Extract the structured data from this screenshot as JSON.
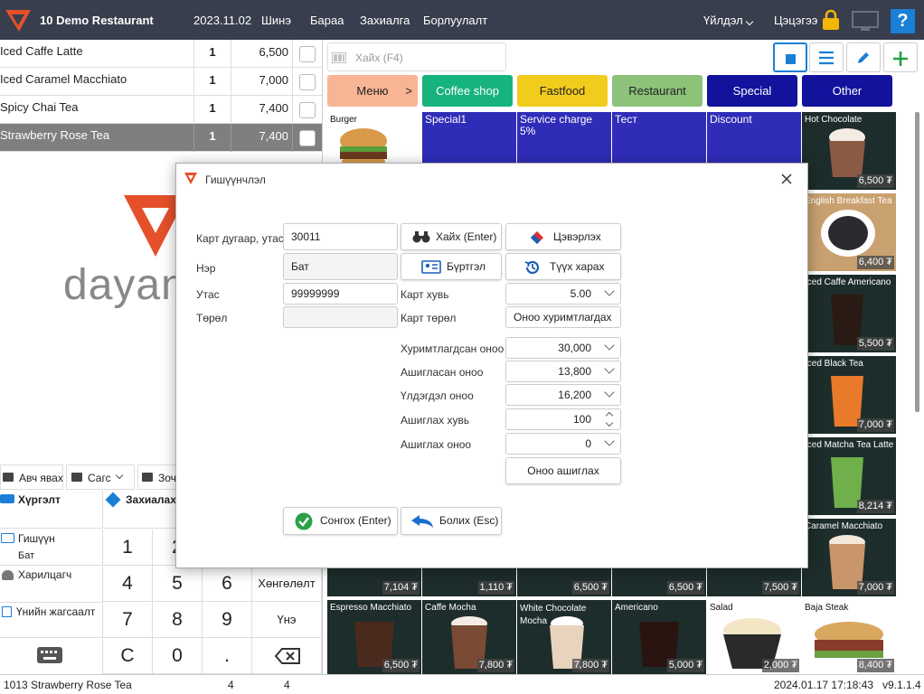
{
  "topbar": {
    "restaurant": "10 Demo Restaurant",
    "date": "2023.11.02",
    "menu": [
      "Шинэ",
      "Бараа",
      "Захиалга",
      "Борлуулалт"
    ],
    "shift": "Үйлдэл",
    "user": "Цэцэгээ"
  },
  "orders": [
    {
      "name": "Iced Caffe Latte",
      "qty": "1",
      "price": "6,500"
    },
    {
      "name": "Iced Caramel Macchiato",
      "qty": "1",
      "price": "7,000"
    },
    {
      "name": "Spicy Chai Tea",
      "qty": "1",
      "price": "7,400"
    },
    {
      "name": "Strawberry Rose Tea",
      "qty": "1",
      "price": "7,400"
    }
  ],
  "brand_text": "dayan",
  "search_placeholder": "Хайх (F4)",
  "categories": [
    {
      "label": "Меню",
      "color": "#f8b596",
      "text": "#222"
    },
    {
      "label": "Coffee shop",
      "color": "#17b37c",
      "text": "#fff"
    },
    {
      "label": "Fastfood",
      "color": "#f2cc1c",
      "text": "#222"
    },
    {
      "label": "Restaurant",
      "color": "#8cc27a",
      "text": "#222"
    },
    {
      "label": "Special",
      "color": "#12129c",
      "text": "#fff"
    },
    {
      "label": "Other",
      "color": "#12129c",
      "text": "#fff"
    }
  ],
  "menu_arrow": ">",
  "products_top": [
    {
      "label": "Burger",
      "price": ""
    },
    {
      "label": "Special1",
      "price": ""
    },
    {
      "label": "Service charge 5%",
      "price": ""
    },
    {
      "label": "Тест",
      "price": ""
    },
    {
      "label": "Discount",
      "price": ""
    },
    {
      "label": "Hot Chocolate",
      "price": "6,500 ₮"
    }
  ],
  "products_right": [
    {
      "label": "English Breakfast Tea",
      "price": "6,400 ₮"
    },
    {
      "label": "Iced Caffe Americano",
      "price": "5,500 ₮"
    },
    {
      "label": "Iced Black Tea",
      "price": "7,000 ₮"
    },
    {
      "label": "Iced Matcha Tea Latte",
      "price": "8,214 ₮"
    },
    {
      "label": "Caramel Macchiato",
      "price": "7,000 ₮"
    }
  ],
  "products_row6_prices": [
    "7,104 ₮",
    "1,110 ₮",
    "6,500 ₮",
    "6,500 ₮",
    "7,500 ₮"
  ],
  "products_bottom": [
    {
      "label": "Espresso Macchiato",
      "price": "6,500 ₮"
    },
    {
      "label": "Caffe Mocha",
      "price": "7,800 ₮"
    },
    {
      "label": "White Chocolate Mocha",
      "price": "7,800 ₮"
    },
    {
      "label": "Americano",
      "price": "5,000 ₮"
    },
    {
      "label": "Salad",
      "price": "2,000 ₮"
    },
    {
      "label": "Baja Steak",
      "price": "8,400 ₮"
    }
  ],
  "bottom_tabs": [
    "Авч явах",
    "Сагс",
    "Зоч"
  ],
  "left_actions": {
    "delivery": "Хүргэлт",
    "orders": "Захиалах",
    "customer": "Гишүүн",
    "customer_name": "Бат",
    "client": "Харилцагч",
    "total_discount": "Үнийн жагсаалт"
  },
  "keypad": {
    "row1": [
      "1",
      "2"
    ],
    "row2": [
      "4",
      "5",
      "6"
    ],
    "row3": [
      "7",
      "8",
      "9"
    ],
    "row4": [
      "C",
      "0",
      "."
    ],
    "discount": "Хөнгөлөлт",
    "price": "Үнэ"
  },
  "dialog": {
    "title": "Гишүүнчлэл",
    "card_label": "Карт дугаар, утас",
    "card_value": "30011",
    "name_label": "Нэр",
    "name_value": "Бат",
    "phone_label": "Утас",
    "phone_value": "99999999",
    "type_label": "Төрөл",
    "type_value": "",
    "search_btn": "Хайх (Enter)",
    "clear_btn": "Цэвэрлэх",
    "register_btn": "Бүртгэл",
    "history_btn": "Түүх харах",
    "card_pct_label": "Карт хувь",
    "card_pct_value": "5.00",
    "card_type_label": "Карт төрөл",
    "card_type_value": "Оноо хуримтлагдах",
    "accum_label": "Хуримтлагдсан оноо",
    "accum_value": "30,000",
    "used_label": "Ашигласан оноо",
    "used_value": "13,800",
    "remain_label": "Үлдэгдэл оноо",
    "remain_value": "16,200",
    "use_pct_label": "Ашиглах хувь",
    "use_pct_value": "100",
    "use_pts_label": "Ашиглах оноо",
    "use_pts_value": "0",
    "use_pts_btn": "Оноо ашиглах",
    "ok_btn": "Сонгох (Enter)",
    "cancel_btn": "Болих (Esc)"
  },
  "status": {
    "item": "1013 Strawberry Rose Tea",
    "n1": "4",
    "n2": "4",
    "datetime": "2024.01.17 17:18:43",
    "version": "v9.1.1.4"
  },
  "colors": {
    "topbar": "#383e4d",
    "accent_blue": "#1a7fd6",
    "brand_orange": "#e4502a",
    "lock_yellow": "#f2b705"
  }
}
